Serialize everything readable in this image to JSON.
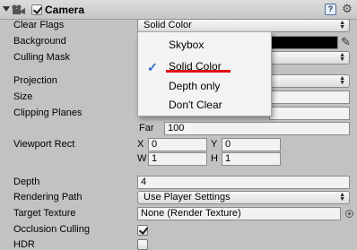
{
  "component": {
    "title": "Camera",
    "help_icon": "?"
  },
  "properties": {
    "clear_flags": {
      "label": "Clear Flags",
      "value": "Solid Color"
    },
    "background": {
      "label": "Background"
    },
    "culling_mask": {
      "label": "Culling Mask"
    },
    "projection": {
      "label": "Projection"
    },
    "size": {
      "label": "Size"
    },
    "clipping_planes": {
      "label": "Clipping Planes",
      "far_label": "Far",
      "far_value": "100"
    },
    "viewport_rect": {
      "label": "Viewport Rect",
      "x_label": "X",
      "x_value": "0",
      "y_label": "Y",
      "y_value": "0",
      "w_label": "W",
      "w_value": "1",
      "h_label": "H",
      "h_value": "1"
    },
    "depth": {
      "label": "Depth",
      "value": "4"
    },
    "rendering_path": {
      "label": "Rendering Path",
      "value": "Use Player Settings"
    },
    "target_texture": {
      "label": "Target Texture",
      "value": "None (Render Texture)"
    },
    "occlusion_culling": {
      "label": "Occlusion Culling",
      "checked": true
    },
    "hdr": {
      "label": "HDR",
      "checked": false
    }
  },
  "dropdown_menu": {
    "items": [
      "Skybox",
      "Solid Color",
      "Depth only",
      "Don't Clear"
    ],
    "selected": "Solid Color",
    "check_mark": "✓",
    "highlight_color": "#e01010"
  },
  "colors": {
    "inspector_bg": "#c2c2c2",
    "background_color_value": "#000000"
  }
}
